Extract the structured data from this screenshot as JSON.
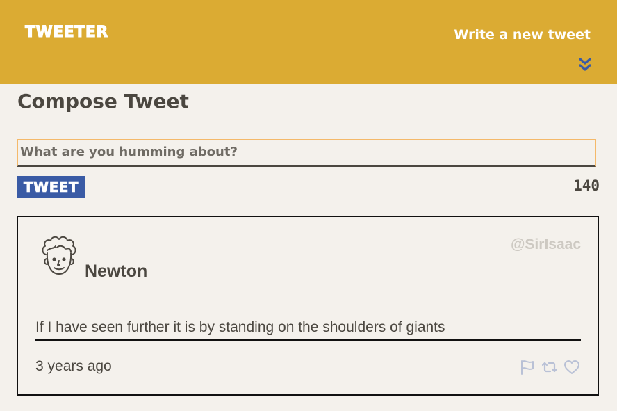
{
  "header": {
    "brand": "TWEETER",
    "write_link": "Write a new tweet",
    "chevron_icon": "double-chevron-down-icon",
    "background_color": "#dbab33"
  },
  "compose": {
    "title": "Compose Tweet",
    "placeholder": "What are you humming about?",
    "button_label": "TWEET",
    "button_color": "#3a5ba5",
    "char_count": "140"
  },
  "tweets": [
    {
      "avatar_icon": "curly-haired-man-avatar-icon",
      "name": "Newton",
      "handle": "@SirIsaac",
      "text": "If I have seen further it is by standing on the shoulders of giants",
      "timestamp": "3 years ago",
      "action_icons": [
        "flag-icon",
        "retweet-icon",
        "heart-icon"
      ]
    }
  ]
}
